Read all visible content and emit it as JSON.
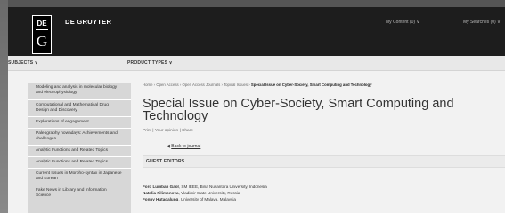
{
  "header": {
    "logo_de": "DE",
    "logo_g": "G",
    "brand": "DE GRUYTER",
    "my_content": "My Content (0) ∨",
    "my_searches": "My Searches (0) ∨"
  },
  "nav": {
    "subjects": "SUBJECTS ∨",
    "product_types": "PRODUCT TYPES ∨"
  },
  "sidebar": {
    "items": [
      {
        "label": "Modeling and analysis in molecular biology and electrophysiology"
      },
      {
        "label": "Computational and Mathematical Drug Design and Discovery"
      },
      {
        "label": "Explorations of engagement"
      },
      {
        "label": "Paleography nowadays: Achievements and challenges"
      },
      {
        "label": "Analytic Functions and Related Topics"
      },
      {
        "label": "Analytic Functions and Related Topics"
      },
      {
        "label": "Current Issues in Morpho-syntax in Japanese and Korean"
      },
      {
        "label": "Fake News in Library and Information Science"
      }
    ]
  },
  "main": {
    "breadcrumb": {
      "home": "Home",
      "sep": "›",
      "open_access": "Open Access",
      "journals": "Open Access Journals",
      "topical": "Topical Issues",
      "current": "Special Issue on Cyber-Society, Smart Computing and Technology"
    },
    "title": "Special Issue on Cyber-Society, Smart Computing and Technology",
    "actions": {
      "print": "Print",
      "sep": "|",
      "opinion": "Your opinion",
      "share": "Share"
    },
    "back": {
      "arrow": "◀",
      "label": "Back to journal"
    },
    "section_title": "GUEST EDITORS",
    "editors": [
      {
        "name": "Ford Lumban Gaol",
        "affiliation": ", SM IEEE, Bina Nusantara University, Indonesia"
      },
      {
        "name": "Natalia Filimonova",
        "affiliation": ", Vladimir State University, Russia"
      },
      {
        "name": "Fonny Hutagalung",
        "affiliation": ", University of Malaya, Malaysia"
      }
    ]
  }
}
